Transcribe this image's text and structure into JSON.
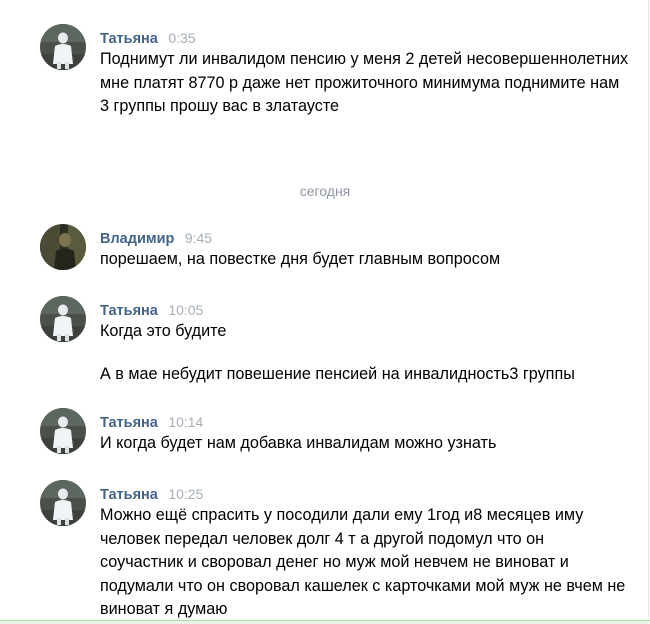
{
  "date_separator": "сегодня",
  "messages": [
    {
      "author": "Татьяна",
      "time": "0:35",
      "avatar": "tatyana-avatar",
      "paragraphs": [
        "Поднимут ли инвалидом пенсию у меня 2 детей несовершеннолетних мне платят 8770 р даже нет прожиточного минимума поднимите нам 3 группы прошу вас в златаусте"
      ]
    },
    {
      "author": "Владимир",
      "time": "9:45",
      "avatar": "vladimir-avatar",
      "paragraphs": [
        "порешаем, на повестке дня будет главным вопросом"
      ]
    },
    {
      "author": "Татьяна",
      "time": "10:05",
      "avatar": "tatyana-avatar",
      "paragraphs": [
        "Когда это будите",
        "А в мае небудит повешение пенсией на инвалидность3 группы"
      ]
    },
    {
      "author": "Татьяна",
      "time": "10:14",
      "avatar": "tatyana-avatar",
      "paragraphs": [
        "И когда будет нам добавка инвалидам можно узнать"
      ]
    },
    {
      "author": "Татьяна",
      "time": "10:25",
      "avatar": "tatyana-avatar",
      "paragraphs": [
        "Можно ещё спрасить у посодили дали ему 1год и8 месяцев иму человек передал человек долг 4 т а другой подомул что он соучастник и своровал денег но муж мой невчем не виноват и подумали что он своровал кашелек с карточками мой муж не вчем не виноват я думаю"
      ]
    }
  ],
  "colors": {
    "author": "#42648b",
    "time": "#a6adb5",
    "separator": "#8c96a2"
  }
}
